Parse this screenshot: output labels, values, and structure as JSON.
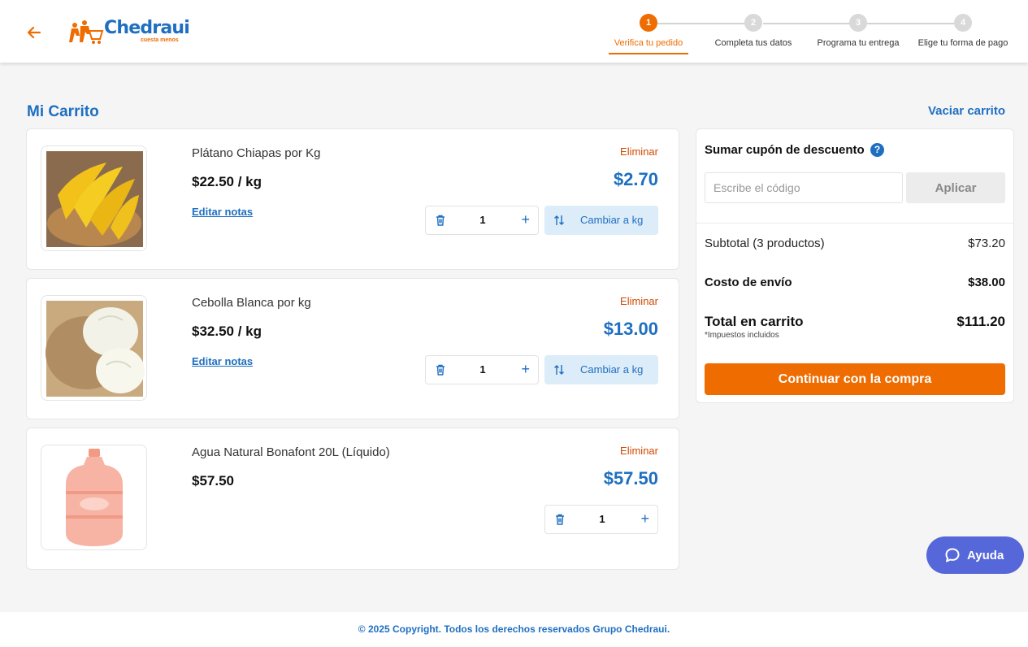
{
  "header": {
    "logo_text": "Chedraui",
    "logo_tagline": "cuesta menos",
    "steps": [
      {
        "number": "1",
        "label": "Verifica tu pedido"
      },
      {
        "number": "2",
        "label": "Completa tus datos"
      },
      {
        "number": "3",
        "label": "Programa tu entrega"
      },
      {
        "number": "4",
        "label": "Elige tu forma de pago"
      }
    ],
    "active_step": 1
  },
  "cart": {
    "title": "Mi Carrito",
    "empty_label": "Vaciar carrito",
    "items": [
      {
        "name": "Plátano Chiapas por Kg",
        "unit_price": "$22.50 / kg",
        "total": "$2.70",
        "quantity": "1",
        "remove_label": "Eliminar",
        "notes_label": "Editar notas",
        "switch_label": "Cambiar a kg"
      },
      {
        "name": "Cebolla Blanca por kg",
        "unit_price": "$32.50 / kg",
        "total": "$13.00",
        "quantity": "1",
        "remove_label": "Eliminar",
        "notes_label": "Editar notas",
        "switch_label": "Cambiar a kg"
      },
      {
        "name": "Agua Natural Bonafont 20L (Líquido)",
        "unit_price": "$57.50",
        "total": "$57.50",
        "quantity": "1",
        "remove_label": "Eliminar"
      }
    ]
  },
  "summary": {
    "coupon_title": "Sumar cupón de descuento",
    "help_glyph": "?",
    "coupon_placeholder": "Escribe el código",
    "apply_label": "Aplicar",
    "subtotal_label": "Subtotal (3 productos)",
    "subtotal_value": "$73.20",
    "shipping_label": "Costo de envío",
    "shipping_value": "$38.00",
    "total_label": "Total en carrito",
    "total_value": "$111.20",
    "tax_note": "*Impuestos incluidos",
    "continue_label": "Continuar con la compra"
  },
  "help": {
    "label": "Ayuda"
  },
  "footer": {
    "copyright": "© 2025 Copyright. Todos los derechos reservados Grupo Chedraui."
  },
  "colors": {
    "brand_blue": "#1f6fc1",
    "brand_orange": "#ef6c00",
    "remove_red": "#d04a02",
    "help_purple": "#5567d9"
  },
  "icons": [
    "arrow-left-icon",
    "trash-icon",
    "plus-icon",
    "swap-icon",
    "question-icon",
    "chat-bubble-icon"
  ]
}
